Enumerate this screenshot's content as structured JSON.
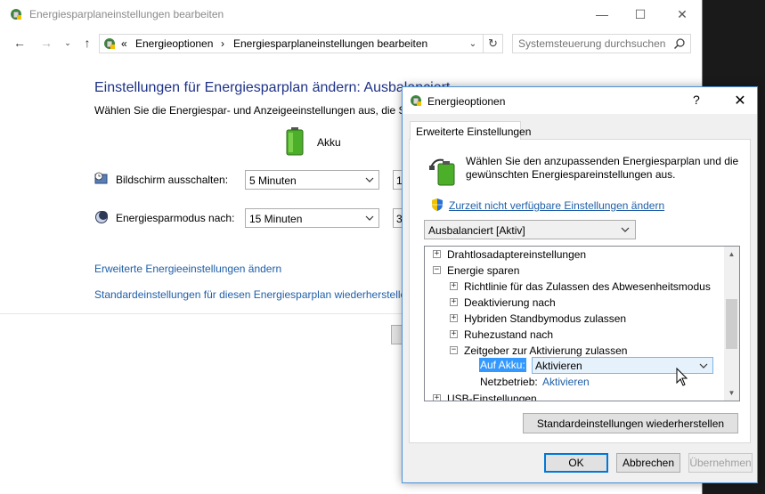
{
  "main_window": {
    "title": "Energiesparplaneinstellungen bearbeiten",
    "breadcrumb_prefix": "«",
    "breadcrumb": [
      "Energieoptionen",
      "Energiesparplaneinstellungen bearbeiten"
    ],
    "breadcrumb_sep": "›",
    "search_placeholder": "Systemsteuerung durchsuchen",
    "heading": "Einstellungen für Energiesparplan ändern: Ausbalanciert",
    "subheading": "Wählen Sie die Energiespar- und Anzeigeeinstellungen aus, die Sie für den Computer verwenden möchten.",
    "battery_label": "Akku",
    "settings": [
      {
        "label": "Bildschirm ausschalten:",
        "value": "5 Minuten",
        "next_value_stub": "1"
      },
      {
        "label": "Energiesparmodus nach:",
        "value": "15 Minuten",
        "next_value_stub": "3"
      }
    ],
    "links": {
      "advanced": "Erweiterte Energieeinstellungen ändern",
      "restore": "Standardeinstellungen für diesen Energiesparplan wiederherstellen"
    }
  },
  "dialog": {
    "title": "Energieoptionen",
    "help": "?",
    "tab": "Erweiterte Einstellungen",
    "description": "Wählen Sie den anzupassenden Energiesparplan und die gewünschten Energiespareinstellungen aus.",
    "unavailable_link": "Zurzeit nicht verfügbare Einstellungen ändern",
    "plan_selected": "Ausbalanciert [Aktiv]",
    "tree": [
      {
        "level": 0,
        "expander": "+",
        "label": "Drahtlosadaptereinstellungen"
      },
      {
        "level": 0,
        "expander": "−",
        "label": "Energie sparen"
      },
      {
        "level": 1,
        "expander": "+",
        "label": "Richtlinie für das Zulassen des Abwesenheitsmodus"
      },
      {
        "level": 1,
        "expander": "+",
        "label": "Deaktivierung nach"
      },
      {
        "level": 1,
        "expander": "+",
        "label": "Hybriden Standbymodus zulassen"
      },
      {
        "level": 1,
        "expander": "+",
        "label": "Ruhezustand nach"
      },
      {
        "level": 1,
        "expander": "−",
        "label": "Zeitgeber zur Aktivierung zulassen"
      },
      {
        "level": 0,
        "expander": "+",
        "label": "USB-Einstellungen"
      }
    ],
    "akku_label": "Auf Akku:",
    "akku_value": "Aktivieren",
    "netz_label": "Netzbetrieb:",
    "netz_value": "Aktivieren",
    "restore_button": "Standardeinstellungen wiederherstellen",
    "buttons": {
      "ok": "OK",
      "cancel": "Abbrechen",
      "apply": "Übernehmen"
    }
  },
  "colors": {
    "heading": "#1e3287",
    "link": "#1f5fa8",
    "selection": "#3399ff",
    "dialog_border": "#4a90d9"
  }
}
